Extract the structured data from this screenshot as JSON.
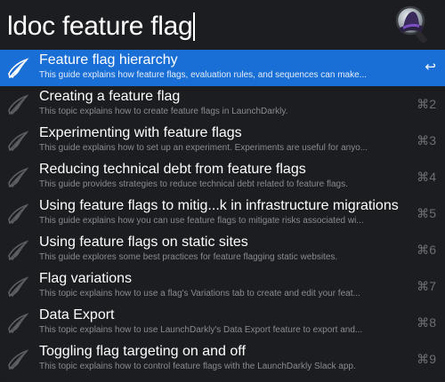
{
  "search": {
    "query": "ldoc feature flag"
  },
  "results": [
    {
      "title": "Feature flag hierarchy",
      "subtitle": "This guide explains how feature flags, evaluation rules, and sequences can make...",
      "shortcut": "↩"
    },
    {
      "title": "Creating a feature flag",
      "subtitle": "This topic explains how to create feature flags in LaunchDarkly.",
      "shortcut": "⌘2"
    },
    {
      "title": "Experimenting with feature flags",
      "subtitle": "This guide explains how to set up an experiment. Experiments are useful for anyo...",
      "shortcut": "⌘3"
    },
    {
      "title": "Reducing technical debt from feature flags",
      "subtitle": "This guide provides strategies to reduce technical debt related to feature flags.",
      "shortcut": "⌘4"
    },
    {
      "title": "Using feature flags to mitig...k in infrastructure migrations",
      "subtitle": "This guide explains how you can use feature flags to mitigate risks associated wi...",
      "shortcut": "⌘5"
    },
    {
      "title": "Using feature flags on static sites",
      "subtitle": "This guide explores some best practices for feature flagging static websites.",
      "shortcut": "⌘6"
    },
    {
      "title": "Flag variations",
      "subtitle": "This topic explains how to use a flag's Variations tab to create and edit your feat...",
      "shortcut": "⌘7"
    },
    {
      "title": "Data Export",
      "subtitle": "This topic explains how to use LaunchDarkly's Data Export feature to export and...",
      "shortcut": "⌘8"
    },
    {
      "title": "Toggling flag targeting on and off",
      "subtitle": "This topic explains how to control feature flags with the LaunchDarkly Slack app.",
      "shortcut": "⌘9"
    }
  ],
  "icons": {
    "row_icon": "launchdarkly-bird-icon",
    "app_logo": "alfred-hat-magnifier-icon"
  },
  "colors": {
    "selection": "#1a6fd6",
    "background": "#1c1d20"
  }
}
